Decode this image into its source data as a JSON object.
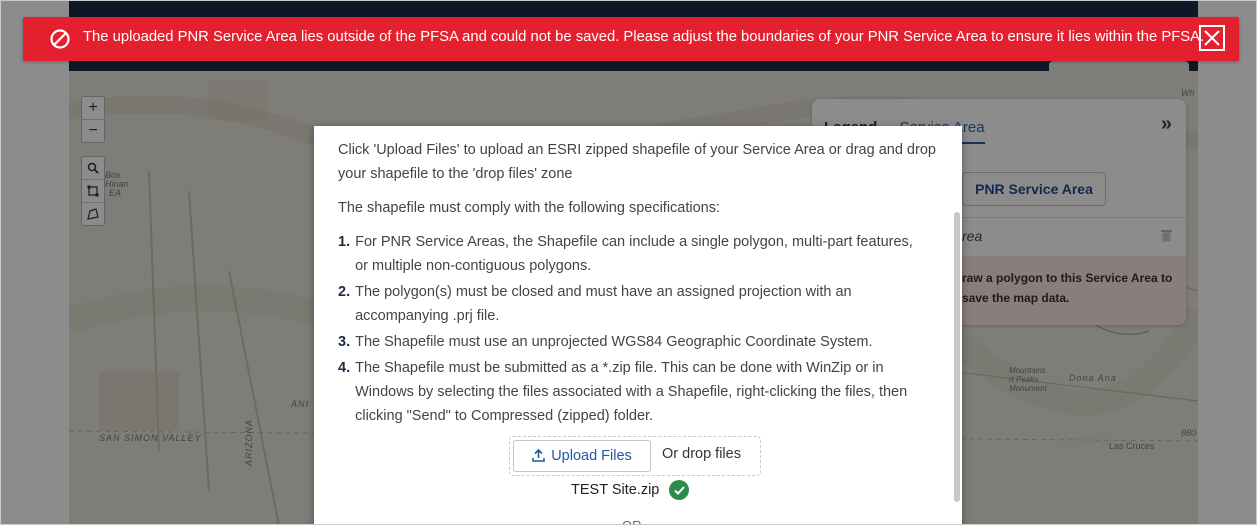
{
  "alert": {
    "message": "The uploaded PNR Service Area lies outside of the PFSA and could not be saved. Please adjust the boundaries of your PNR Service Area to ensure it lies within the PFSA.",
    "icon": "prohibited-icon",
    "close_icon": "close-icon",
    "color": "#e5202e"
  },
  "map": {
    "zoom_in": "+",
    "zoom_out": "−",
    "tools": [
      "search-icon",
      "select-box-icon",
      "draw-polygon-icon"
    ],
    "labels": {
      "san_simon": "SAN SIMON VALLEY",
      "las_cruces": "Las Cruces",
      "dona_ana": "Dona Ana",
      "mountains": "Mountains",
      "peaks": "rt Peaks",
      "monument": "Monument",
      "box": "Box",
      "hinan": "Hinan",
      "ea": "EA",
      "arizona": "ARIZONA",
      "ani": "ANI",
      "wh": "Wh",
      "elev": "880"
    }
  },
  "legend_panel": {
    "tab_legend": "Legend",
    "tab_service_area": "Service Area",
    "collapse": "»",
    "pnr_button": "PNR Service Area",
    "service_area_row": "rea",
    "warning": "raw a polygon to this Service Area to save the map data."
  },
  "modal": {
    "intro": "Click 'Upload Files' to upload an ESRI zipped shapefile of your Service Area or drag and drop your shapefile to the 'drop files' zone",
    "spec_heading": "The shapefile must comply with the following specifications:",
    "specs": [
      {
        "num": "1.",
        "text": "For PNR Service Areas, the Shapefile can include a single polygon, multi-part features, or multiple non-contiguous polygons."
      },
      {
        "num": "2.",
        "text": "The polygon(s) must be closed and must have an assigned projection with an accompanying .prj file."
      },
      {
        "num": "3.",
        "text": "The Shapefile must use an unprojected WGS84 Geographic Coordinate System."
      },
      {
        "num": "4.",
        "text": "The Shapefile must be submitted as a *.zip file. This can be done with WinZip or in Windows by selecting the files associated with a Shapefile, right-clicking the files, then clicking \"Send\" to Compressed (zipped) folder."
      }
    ],
    "upload_button": "Upload Files",
    "drop_label": "Or drop files",
    "uploaded_file": "TEST Site.zip",
    "or_text": "OR"
  }
}
